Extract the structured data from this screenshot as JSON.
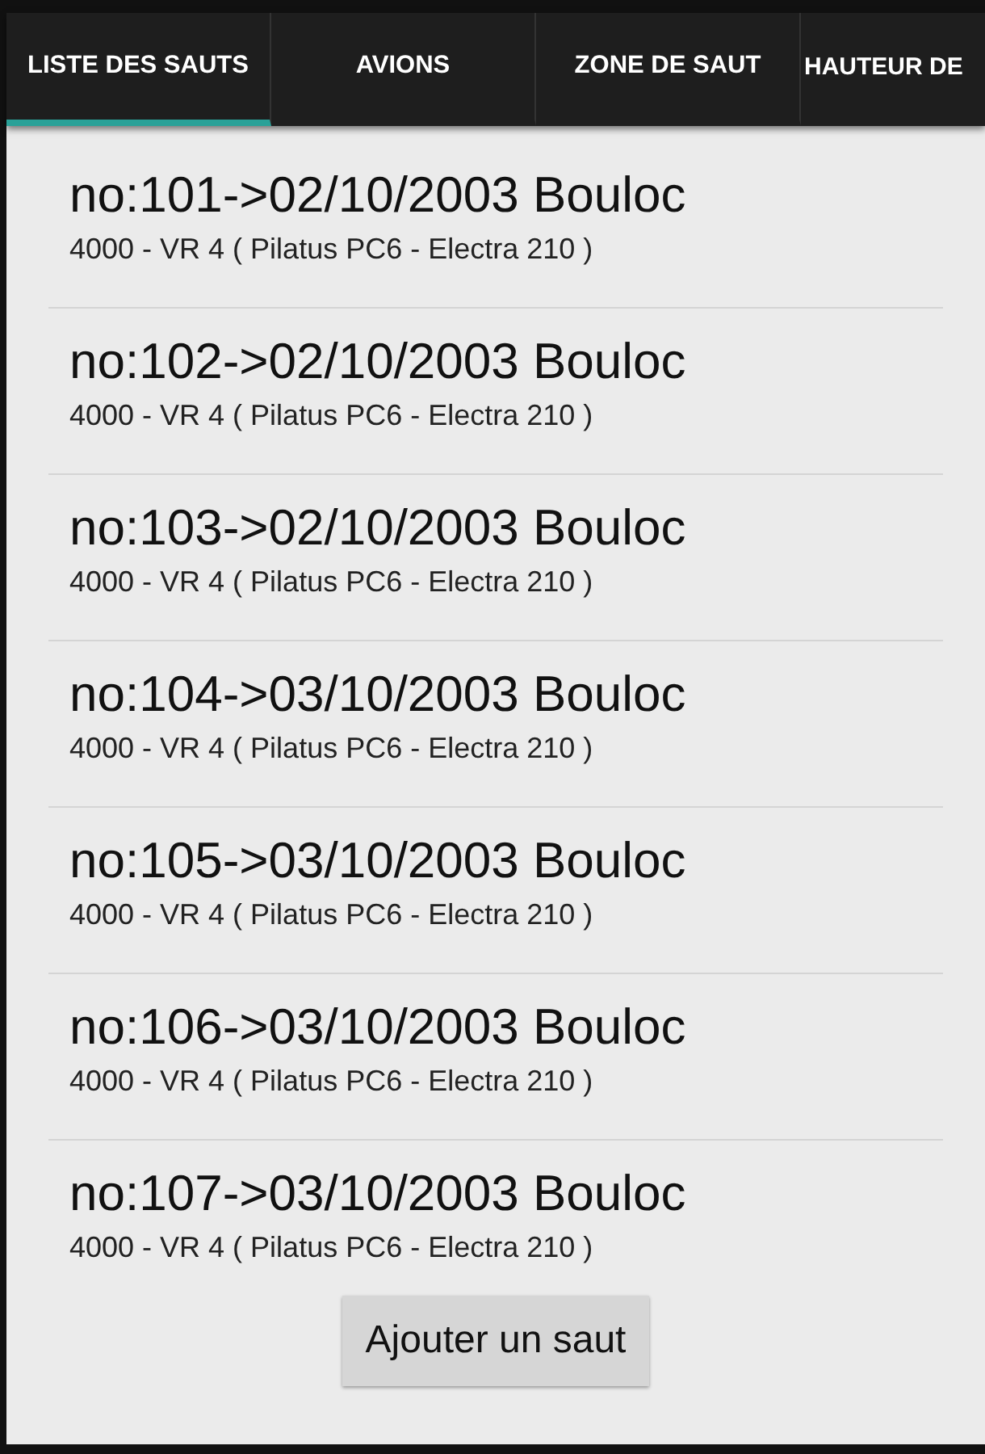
{
  "tabs": [
    {
      "label": "LISTE DES SAUTS",
      "selected": true
    },
    {
      "label": "AVIONS",
      "selected": false
    },
    {
      "label": "ZONE DE SAUT",
      "selected": false
    },
    {
      "label": "HAUTEUR DE",
      "selected": false
    }
  ],
  "jumps": [
    {
      "title": "no:101->02/10/2003 Bouloc",
      "subtitle": "4000 - VR 4 ( Pilatus PC6 - Electra 210 )"
    },
    {
      "title": "no:102->02/10/2003 Bouloc",
      "subtitle": "4000 - VR 4 ( Pilatus PC6 - Electra 210 )"
    },
    {
      "title": "no:103->02/10/2003 Bouloc",
      "subtitle": "4000 - VR 4 ( Pilatus PC6 - Electra 210 )"
    },
    {
      "title": "no:104->03/10/2003 Bouloc",
      "subtitle": "4000 - VR 4 ( Pilatus PC6 - Electra 210 )"
    },
    {
      "title": "no:105->03/10/2003 Bouloc",
      "subtitle": "4000 - VR 4 ( Pilatus PC6 - Electra 210 )"
    },
    {
      "title": "no:106->03/10/2003 Bouloc",
      "subtitle": "4000 - VR 4 ( Pilatus PC6 - Electra 210 )"
    },
    {
      "title": "no:107->03/10/2003 Bouloc",
      "subtitle": "4000 - VR 4 ( Pilatus PC6 - Electra 210 )"
    }
  ],
  "add_button": "Ajouter un saut"
}
